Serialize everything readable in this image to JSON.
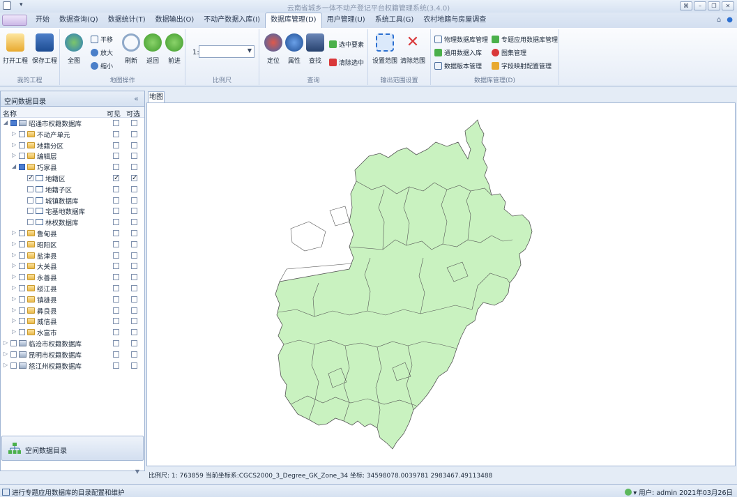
{
  "window": {
    "title": "云南省城乡一体不动产登记平台权籍管理系统(3.4.0)",
    "quick_access": "▾",
    "controls": [
      "⌘",
      "–",
      "❐",
      "✕"
    ]
  },
  "menu": {
    "tabs": [
      "开始",
      "数据查询(Q)",
      "数据统计(T)",
      "数据输出(O)",
      "不动产数据入库(I)",
      "数据库管理(D)",
      "用户管理(U)",
      "系统工具(G)",
      "农村地籍与房屋调查"
    ],
    "active_tab": "数据库管理(D)",
    "right_icons": [
      "⌂",
      "●"
    ]
  },
  "ribbon": {
    "project": {
      "label": "我的工程",
      "open": "打开工程",
      "save": "保存工程"
    },
    "map_ops": {
      "label": "地图操作",
      "full": "全图",
      "pan": "平移",
      "zoom_in": "放大",
      "zoom_out": "缩小",
      "refresh": "刷新",
      "back": "返回",
      "forward": "前进"
    },
    "scale": {
      "label": "比例尺",
      "prefix": "1:",
      "value": ""
    },
    "query": {
      "label": "查询",
      "locate": "定位",
      "attribute": "属性",
      "find": "查找",
      "select_feature": "选中要素",
      "clear_select": "清除选中"
    },
    "output_range": {
      "label": "输出范围设置",
      "set_range": "设置范围",
      "clear_range": "清除范围"
    },
    "db_manage": {
      "label": "数据库管理(D)",
      "physical": "物理数据库管理",
      "thematic": "专题应用数据库管理",
      "general_import": "通用数据入库",
      "atlas": "图集管理",
      "version": "数据版本管理",
      "field_map": "字段映射配置管理"
    }
  },
  "left_panel": {
    "title": "空间数据目录",
    "collapse": "«",
    "columns": {
      "name": "名称",
      "visible": "可见",
      "selectable": "可选"
    },
    "tree": [
      {
        "label": "昭通市权籍数据库",
        "level": 0,
        "expanded": true,
        "type": "db",
        "checked": "partial"
      },
      {
        "label": "不动产单元",
        "level": 1,
        "expanded": false,
        "type": "folder"
      },
      {
        "label": "地籍分区",
        "level": 1,
        "expanded": false,
        "type": "folder"
      },
      {
        "label": "编辑层",
        "level": 1,
        "expanded": false,
        "type": "folder"
      },
      {
        "label": "巧家县",
        "level": 1,
        "expanded": true,
        "type": "folder",
        "checked": "partial"
      },
      {
        "label": "地籍区",
        "level": 2,
        "type": "layer",
        "checked": "true",
        "visible": true,
        "selectable": true
      },
      {
        "label": "地籍子区",
        "level": 2,
        "type": "layer"
      },
      {
        "label": "城镇数据库",
        "level": 2,
        "type": "layer"
      },
      {
        "label": "宅基地数据库",
        "level": 2,
        "type": "layer"
      },
      {
        "label": "林权数据库",
        "level": 2,
        "type": "layer"
      },
      {
        "label": "鲁甸县",
        "level": 1,
        "expanded": false,
        "type": "folder"
      },
      {
        "label": "昭阳区",
        "level": 1,
        "expanded": false,
        "type": "folder"
      },
      {
        "label": "盐津县",
        "level": 1,
        "expanded": false,
        "type": "folder"
      },
      {
        "label": "大关县",
        "level": 1,
        "expanded": false,
        "type": "folder"
      },
      {
        "label": "永善县",
        "level": 1,
        "expanded": false,
        "type": "folder"
      },
      {
        "label": "绥江县",
        "level": 1,
        "expanded": false,
        "type": "folder"
      },
      {
        "label": "镇雄县",
        "level": 1,
        "expanded": false,
        "type": "folder"
      },
      {
        "label": "彝良县",
        "level": 1,
        "expanded": false,
        "type": "folder"
      },
      {
        "label": "威信县",
        "level": 1,
        "expanded": false,
        "type": "folder"
      },
      {
        "label": "水富市",
        "level": 1,
        "expanded": false,
        "type": "folder"
      },
      {
        "label": "临沧市权籍数据库",
        "level": 0,
        "expanded": false,
        "type": "db"
      },
      {
        "label": "昆明市权籍数据库",
        "level": 0,
        "expanded": false,
        "type": "db"
      },
      {
        "label": "怒江州权籍数据库",
        "level": 0,
        "expanded": false,
        "type": "db"
      }
    ],
    "bottom_button": "空间数据目录"
  },
  "map": {
    "tab": "地图",
    "fill_color": "#c9f2c0",
    "stroke_color": "#555555",
    "status": "比例尺: 1: 763859  当前坐标系:CGCS2000_3_Degree_GK_Zone_34 坐标:  34598078.0039781 2983467.49113488"
  },
  "statusbar": {
    "left": "进行专题应用数据库的目录配置和维护",
    "right": "▾ 用户: admin  2021年03月26日"
  }
}
